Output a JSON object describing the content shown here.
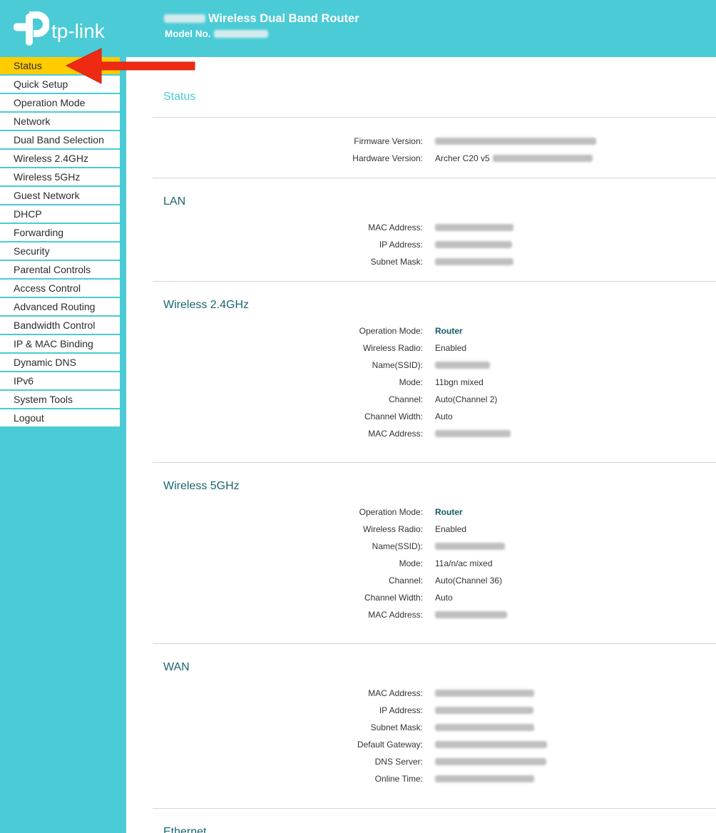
{
  "header": {
    "logo_text": "tp-link",
    "title": "Wireless Dual Band Router",
    "model_label": "Model No."
  },
  "colors": {
    "brand_teal": "#4acbd6",
    "active_menu_bg": "#ffcc00",
    "section_title": "#1a6570",
    "annotation_arrow": "#ee2a12"
  },
  "icons": {
    "logo": "tp-link-logo-icon",
    "annotation": "red-arrow-icon"
  },
  "sidebar": {
    "items": [
      {
        "label": "Status",
        "active": true
      },
      {
        "label": "Quick Setup"
      },
      {
        "label": "Operation Mode"
      },
      {
        "label": "Network"
      },
      {
        "label": "Dual Band Selection"
      },
      {
        "label": "Wireless 2.4GHz"
      },
      {
        "label": "Wireless 5GHz"
      },
      {
        "label": "Guest Network"
      },
      {
        "label": "DHCP"
      },
      {
        "label": "Forwarding"
      },
      {
        "label": "Security"
      },
      {
        "label": "Parental Controls"
      },
      {
        "label": "Access Control"
      },
      {
        "label": "Advanced Routing"
      },
      {
        "label": "Bandwidth Control"
      },
      {
        "label": "IP & MAC Binding"
      },
      {
        "label": "Dynamic DNS"
      },
      {
        "label": "IPv6"
      },
      {
        "label": "System Tools"
      },
      {
        "label": "Logout"
      }
    ]
  },
  "page_title": "Status",
  "status": {
    "version": {
      "rows": [
        {
          "label": "Firmware Version:"
        },
        {
          "label": "Hardware Version:",
          "value": "Archer C20 v5"
        }
      ]
    },
    "lan": {
      "title": "LAN",
      "rows": [
        {
          "label": "MAC Address:"
        },
        {
          "label": "IP Address:"
        },
        {
          "label": "Subnet Mask:"
        }
      ]
    },
    "wireless_24": {
      "title": "Wireless 2.4GHz",
      "rows": [
        {
          "label": "Operation Mode:",
          "value": "Router"
        },
        {
          "label": "Wireless Radio:",
          "value": "Enabled"
        },
        {
          "label": "Name(SSID):"
        },
        {
          "label": "Mode:",
          "value": "11bgn mixed"
        },
        {
          "label": "Channel:",
          "value": "Auto(Channel 2)"
        },
        {
          "label": "Channel Width:",
          "value": "Auto"
        },
        {
          "label": "MAC Address:"
        }
      ]
    },
    "wireless_5": {
      "title": "Wireless 5GHz",
      "rows": [
        {
          "label": "Operation Mode:",
          "value": "Router"
        },
        {
          "label": "Wireless Radio:",
          "value": "Enabled"
        },
        {
          "label": "Name(SSID):"
        },
        {
          "label": "Mode:",
          "value": "11a/n/ac mixed"
        },
        {
          "label": "Channel:",
          "value": "Auto(Channel 36)"
        },
        {
          "label": "Channel Width:",
          "value": "Auto"
        },
        {
          "label": "MAC Address:"
        }
      ]
    },
    "wan": {
      "title": "WAN",
      "rows": [
        {
          "label": "MAC Address:"
        },
        {
          "label": "IP Address:"
        },
        {
          "label": "Subnet Mask:"
        },
        {
          "label": "Default Gateway:"
        },
        {
          "label": "DNS Server:"
        },
        {
          "label": "Online Time:"
        }
      ]
    },
    "ethernet": {
      "title": "Ethernet"
    }
  }
}
